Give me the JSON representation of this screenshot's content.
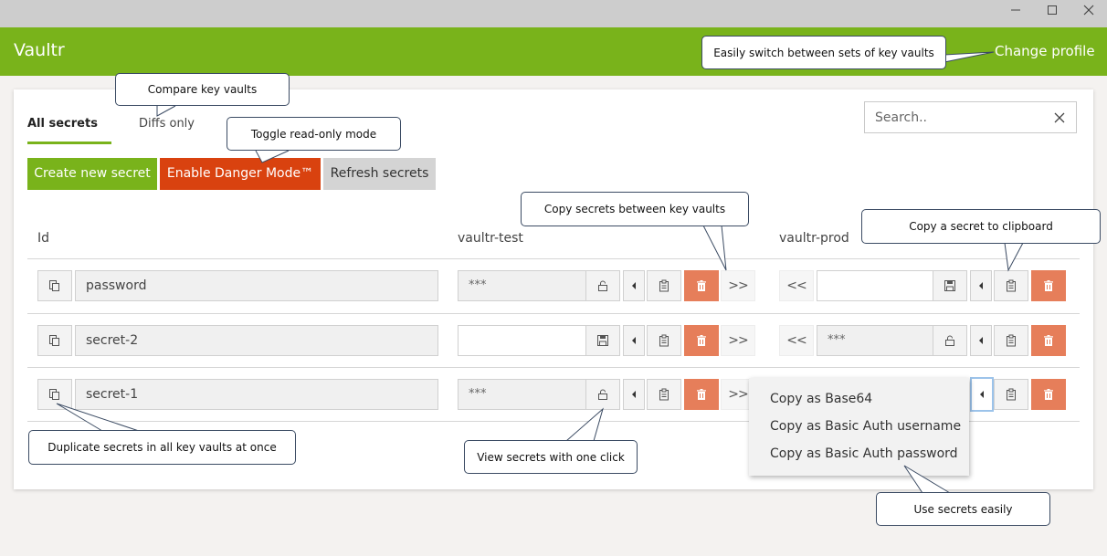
{
  "window": {
    "minimize_glyph": "—",
    "maximize_glyph": "☐",
    "close_glyph": "✕"
  },
  "app": {
    "title": "Vaultr",
    "change_profile": "Change profile"
  },
  "tabs": {
    "all": "All secrets",
    "diffs": "Diffs only"
  },
  "search": {
    "placeholder": "Search..",
    "clear_icon": "close-icon"
  },
  "toolbar": {
    "create": "Create new secret",
    "danger": "Enable Danger Mode™",
    "refresh": "Refresh secrets"
  },
  "columns": {
    "id": "Id",
    "vault1": "vaultr-test",
    "vault2": "vaultr-prod"
  },
  "rows": [
    {
      "id": "password",
      "test_value": "***",
      "test_action_icon": "lock-icon",
      "prod_value": "",
      "prod_action_icon": "save-icon"
    },
    {
      "id": "secret-2",
      "test_value": "",
      "test_action_icon": "save-icon",
      "prod_value": "***",
      "prod_action_icon": "lock-icon"
    },
    {
      "id": "secret-1",
      "test_value": "***",
      "test_action_icon": "lock-icon",
      "prod_value": "",
      "prod_action_icon": ""
    }
  ],
  "copy_menu": {
    "items": [
      "Copy as Base64",
      "Copy as Basic Auth username",
      "Copy as Basic Auth password"
    ]
  },
  "callouts": {
    "compare": "Compare key vaults",
    "readonly": "Toggle read-only mode",
    "switch": "Easily switch between sets of key vaults",
    "copy_between": "Copy secrets between key vaults",
    "clipboard": "Copy a secret to clipboard",
    "duplicate": "Duplicate secrets in all key vaults at once",
    "view": "View secrets with one click",
    "use": "Use secrets easily"
  },
  "glyphs": {
    "copy_right": ">>",
    "copy_left": "<<"
  },
  "colors": {
    "brand": "#79b31b",
    "danger": "#d9420f",
    "delete": "#e67e5a",
    "refresh": "#d4d4d4"
  }
}
